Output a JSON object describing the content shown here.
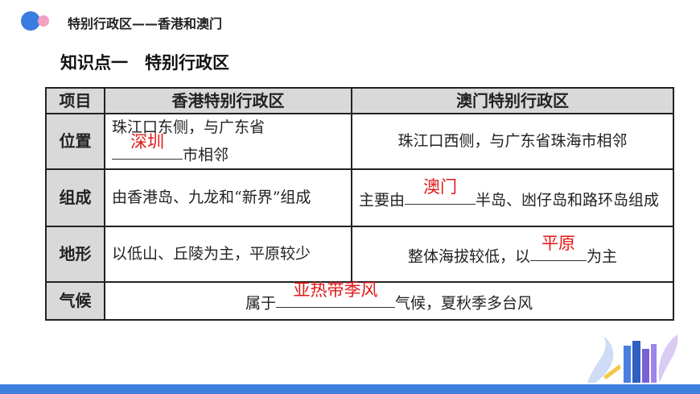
{
  "header": {
    "title": "特别行政区——香港和澳门"
  },
  "section": {
    "title": "知识点一　特别行政区"
  },
  "table": {
    "headers": [
      "项目",
      "香港特别行政区",
      "澳门特别行政区"
    ],
    "rows": [
      {
        "label": "位置",
        "hk_text1": "珠江口东侧，与广东省",
        "hk_answer": "深圳",
        "hk_text2": "市相邻",
        "macau": "珠江口西侧，与广东省珠海市相邻"
      },
      {
        "label": "组成",
        "hk": "由香港岛、九龙和“新界”组成",
        "macau_text1": "主要由",
        "macau_answer": "澳门",
        "macau_text2": "半岛、凼仔岛和路环岛组成"
      },
      {
        "label": "地形",
        "hk": "以低山、丘陵为主，平原较少",
        "macau_text1": "整体海拔较低，以",
        "macau_answer": "平原",
        "macau_text2": "为主"
      },
      {
        "label": "气候",
        "text1": "属于",
        "answer": "亚热带季风",
        "text2": "气候，夏秋季多台风"
      }
    ]
  },
  "colors": {
    "answer": "#e21818",
    "header_bg": "#d9d9d9",
    "accent": "#3f7fe0"
  }
}
